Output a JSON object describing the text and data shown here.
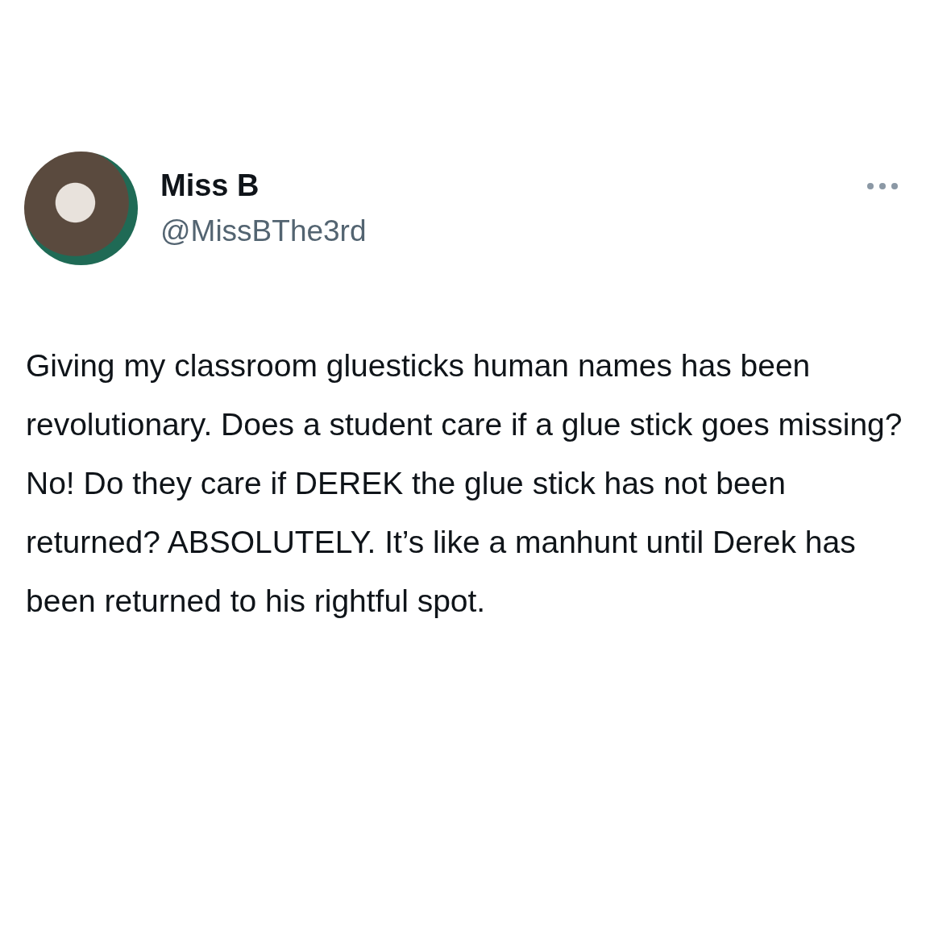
{
  "author": {
    "name": "Miss B",
    "handle": "@MissBThe3rd"
  },
  "tweet": {
    "text": "Giving my classroom gluesticks human names has been revolutionary. Does a student care if a glue stick goes missing? No! Do they care if DEREK the glue stick has not been returned? ABSOLUTELY. It’s like a manhunt until Derek has been returned to his rightful spot."
  }
}
